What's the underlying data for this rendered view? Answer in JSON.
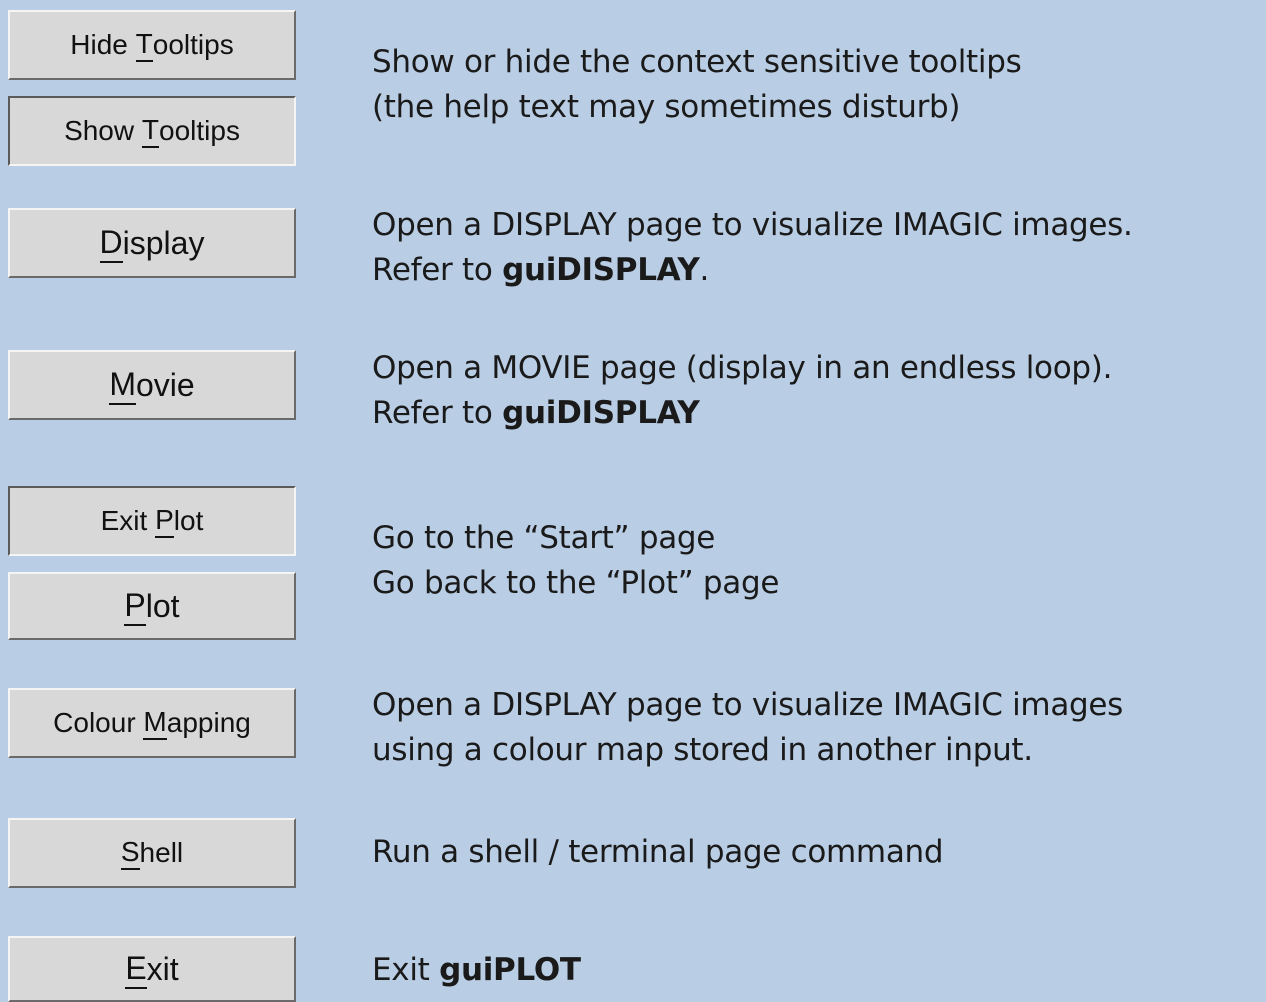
{
  "buttons": {
    "hide_tooltips": {
      "pre": "Hide ",
      "key": "T",
      "post": "ooltips"
    },
    "show_tooltips": {
      "pre": "Show ",
      "key": "T",
      "post": "ooltips"
    },
    "display": {
      "pre": "",
      "key": "D",
      "post": "isplay"
    },
    "movie": {
      "pre": "",
      "key": "M",
      "post": "ovie"
    },
    "exit_plot": {
      "pre": "Exit ",
      "key": "P",
      "post": "lot"
    },
    "plot": {
      "pre": "",
      "key": "P",
      "post": "lot"
    },
    "colour_mapping": {
      "pre": "Colour ",
      "key": "M",
      "post": "apping"
    },
    "shell": {
      "pre": "",
      "key": "S",
      "post": "hell"
    },
    "exit": {
      "pre": "",
      "key": "E",
      "post": "xit"
    }
  },
  "descriptions": {
    "tooltips_1": "Show or hide the context sensitive tooltips",
    "tooltips_2": "(the help text may sometimes disturb)",
    "display_1": "Open a DISPLAY page to visualize IMAGIC images.",
    "display_2_pre": "Refer to ",
    "display_2_bold": "guiDISPLAY",
    "display_2_post": ".",
    "movie_1": "Open a MOVIE page (display in an endless loop).",
    "movie_2_pre": "Refer to ",
    "movie_2_bold": "guiDISPLAY",
    "exit_plot": "Go to the “Start” page",
    "plot": "Go back to the “Plot” page",
    "colour_1": "Open a DISPLAY page to visualize IMAGIC images",
    "colour_2": "using a colour map stored in another input.",
    "shell": "Run a shell / terminal page command",
    "exit_pre": "Exit ",
    "exit_bold": "guiPLOT"
  }
}
